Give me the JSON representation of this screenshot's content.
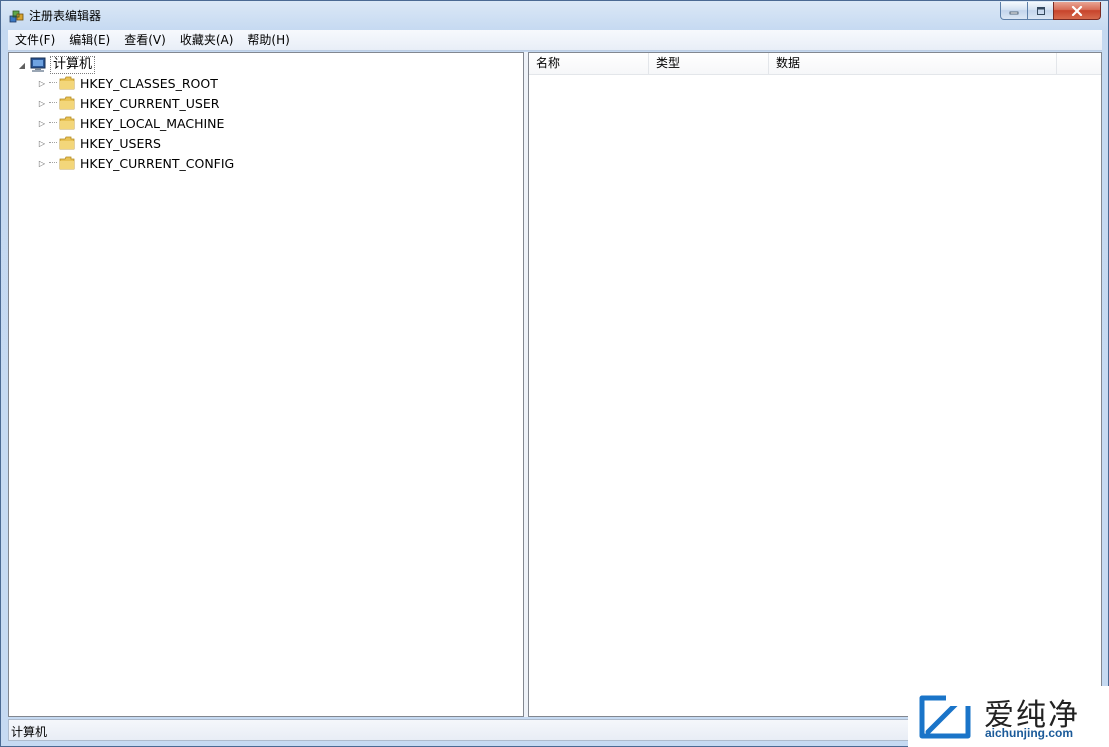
{
  "window": {
    "title": "注册表编辑器"
  },
  "menu": {
    "items": [
      {
        "label": "文件(F)"
      },
      {
        "label": "编辑(E)"
      },
      {
        "label": "查看(V)"
      },
      {
        "label": "收藏夹(A)"
      },
      {
        "label": "帮助(H)"
      }
    ]
  },
  "tree": {
    "root": {
      "label": "计算机",
      "toggle": "◢"
    },
    "keys": [
      {
        "label": "HKEY_CLASSES_ROOT",
        "toggle": "▷"
      },
      {
        "label": "HKEY_CURRENT_USER",
        "toggle": "▷"
      },
      {
        "label": "HKEY_LOCAL_MACHINE",
        "toggle": "▷"
      },
      {
        "label": "HKEY_USERS",
        "toggle": "▷"
      },
      {
        "label": "HKEY_CURRENT_CONFIG",
        "toggle": "▷"
      }
    ]
  },
  "list": {
    "columns": [
      {
        "label": "名称"
      },
      {
        "label": "类型"
      },
      {
        "label": "数据"
      }
    ]
  },
  "status": {
    "text": "计算机"
  },
  "watermark": {
    "brand": "爱纯净",
    "url": "aichunjing.com"
  },
  "icons": {
    "app": "registry-editor-icon",
    "computer": "computer-icon",
    "folder": "folder-icon",
    "minimize": "minimize-icon",
    "maximize": "maximize-icon",
    "close": "close-icon"
  },
  "colors": {
    "folder": "#e8c255",
    "close_button": "#c7432b",
    "watermark_url": "#1a5a99"
  }
}
